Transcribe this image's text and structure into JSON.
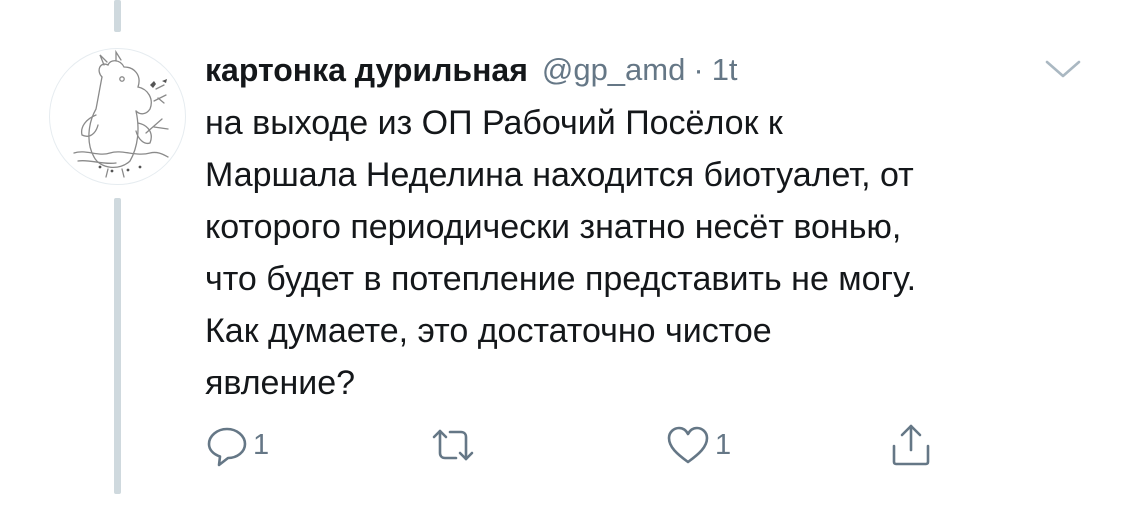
{
  "tweet": {
    "author": {
      "display_name": "картонка дурильная",
      "handle": "@gp_amd",
      "separator": "·",
      "time": "1t"
    },
    "text_lines": [
      "на выходе из ОП Рабочий Посёлок к",
      "Маршала Неделина находится биотуалет, от",
      "которого периодически знатно несёт вонью,",
      "что будет в потепление представить не могу.",
      "Как думаете, это достаточно чистое",
      "явление?"
    ],
    "actions": {
      "reply": {
        "icon": "reply-icon",
        "count": "1"
      },
      "retweet": {
        "icon": "retweet-icon",
        "count": ""
      },
      "like": {
        "icon": "heart-icon",
        "count": "1"
      },
      "share": {
        "icon": "share-icon",
        "count": ""
      }
    },
    "menu_icon": "chevron-down-icon",
    "avatar_icon": "moomin-avatar-icon"
  },
  "colors": {
    "text_primary": "#14171a",
    "text_secondary": "#657786",
    "thread_line": "#cfd9de"
  }
}
